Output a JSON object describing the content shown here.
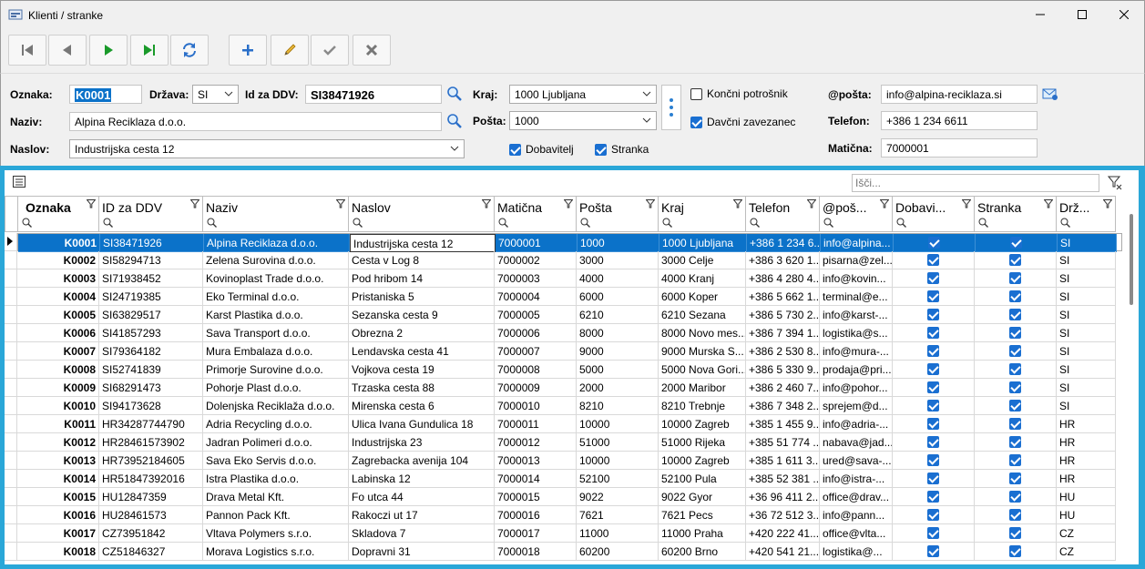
{
  "window": {
    "title": "Klienti / stranke"
  },
  "form": {
    "oznaka_label": "Oznaka:",
    "oznaka_value": "K0001",
    "drzava_label": "Država:",
    "drzava_value": "SI",
    "ddv_label": "Id za DDV:",
    "ddv_value": "SI38471926",
    "kraj_label": "Kraj:",
    "kraj_value": "1000 Ljubljana",
    "koncni_label": "Končni potrošnik",
    "davcni_label": "Davčni zavezanec",
    "posta_email_label": "@pošta:",
    "email_value": "info@alpina-reciklaza.si",
    "naziv_label": "Naziv:",
    "naziv_value": "Alpina Reciklaza d.o.o.",
    "posta_label": "Pošta:",
    "posta_value": "1000",
    "telefon_label": "Telefon:",
    "telefon_value": "+386 1 234 6611",
    "naslov_label": "Naslov:",
    "naslov_value": "Industrijska cesta 12",
    "dobavitelj_label": "Dobavitelj",
    "stranka_label": "Stranka",
    "maticna_label": "Matična:",
    "maticna_value": "7000001"
  },
  "grid": {
    "search_placeholder": "Išči...",
    "columns": [
      "Oznaka",
      "ID za DDV",
      "Naziv",
      "Naslov",
      "Matična",
      "Pošta",
      "Kraj",
      "Telefon",
      "@poš...",
      "Dobavi...",
      "Stranka",
      "Drž..."
    ],
    "rows": [
      [
        "K0001",
        "SI38471926",
        "Alpina Reciklaza d.o.o.",
        "Industrijska cesta 12",
        "7000001",
        "1000",
        "1000 Ljubljana",
        "+386 1 234 6...",
        "info@alpina...",
        "SI"
      ],
      [
        "K0002",
        "SI58294713",
        "Zelena Surovina d.o.o.",
        "Cesta v Log 8",
        "7000002",
        "3000",
        "3000 Celje",
        "+386 3 620 1...",
        "pisarna@zel...",
        "SI"
      ],
      [
        "K0003",
        "SI71938452",
        "Kovinoplast Trade d.o.o.",
        "Pod hribom 14",
        "7000003",
        "4000",
        "4000 Kranj",
        "+386 4 280 4...",
        "info@kovin...",
        "SI"
      ],
      [
        "K0004",
        "SI24719385",
        "Eko Terminal d.o.o.",
        "Pristaniska 5",
        "7000004",
        "6000",
        "6000 Koper",
        "+386 5 662 1...",
        "terminal@e...",
        "SI"
      ],
      [
        "K0005",
        "SI63829517",
        "Karst Plastika d.o.o.",
        "Sezanska cesta 9",
        "7000005",
        "6210",
        "6210 Sezana",
        "+386 5 730 2...",
        "info@karst-...",
        "SI"
      ],
      [
        "K0006",
        "SI41857293",
        "Sava Transport d.o.o.",
        "Obrezna 2",
        "7000006",
        "8000",
        "8000 Novo mes...",
        "+386 7 394 1...",
        "logistika@s...",
        "SI"
      ],
      [
        "K0007",
        "SI79364182",
        "Mura Embalaza d.o.o.",
        "Lendavska cesta 41",
        "7000007",
        "9000",
        "9000 Murska S...",
        "+386 2 530 8...",
        "info@mura-...",
        "SI"
      ],
      [
        "K0008",
        "SI52741839",
        "Primorje Surovine d.o.o.",
        "Vojkova cesta 19",
        "7000008",
        "5000",
        "5000 Nova Gori...",
        "+386 5 330 9...",
        "prodaja@pri...",
        "SI"
      ],
      [
        "K0009",
        "SI68291473",
        "Pohorje Plast d.o.o.",
        "Trzaska cesta 88",
        "7000009",
        "2000",
        "2000 Maribor",
        "+386 2 460 7...",
        "info@pohor...",
        "SI"
      ],
      [
        "K0010",
        "SI94173628",
        "Dolenjska Reciklaža d.o.o.",
        "Mirenska cesta 6",
        "7000010",
        "8210",
        "8210 Trebnje",
        "+386 7 348 2...",
        "sprejem@d...",
        "SI"
      ],
      [
        "K0011",
        "HR34287744790",
        "Adria Recycling d.o.o.",
        "Ulica Ivana Gundulica 18",
        "7000011",
        "10000",
        "10000 Zagreb",
        "+385 1 455 9...",
        "info@adria-...",
        "HR"
      ],
      [
        "K0012",
        "HR28461573902",
        "Jadran Polimeri d.o.o.",
        "Industrijska 23",
        "7000012",
        "51000",
        "51000 Rijeka",
        "+385 51 774 ...",
        "nabava@jad...",
        "HR"
      ],
      [
        "K0013",
        "HR73952184605",
        "Sava Eko Servis d.o.o.",
        "Zagrebacka avenija 104",
        "7000013",
        "10000",
        "10000 Zagreb",
        "+385 1 611 3...",
        "ured@sava-...",
        "HR"
      ],
      [
        "K0014",
        "HR51847392016",
        "Istra Plastika d.o.o.",
        "Labinska 12",
        "7000014",
        "52100",
        "52100 Pula",
        "+385 52 381 ...",
        "info@istra-...",
        "HR"
      ],
      [
        "K0015",
        "HU12847359",
        "Drava Metal Kft.",
        "Fo utca 44",
        "7000015",
        "9022",
        "9022 Gyor",
        "+36 96 411 2...",
        "office@drav...",
        "HU"
      ],
      [
        "K0016",
        "HU28461573",
        "Pannon Pack Kft.",
        "Rakoczi ut 17",
        "7000016",
        "7621",
        "7621 Pecs",
        "+36 72 512 3...",
        "info@pann...",
        "HU"
      ],
      [
        "K0017",
        "CZ73951842",
        "Vltava Polymers s.r.o.",
        "Skladova 7",
        "7000017",
        "11000",
        "11000 Praha",
        "+420 222 41...",
        "office@vlta...",
        "CZ"
      ],
      [
        "K0018",
        "CZ51846327",
        "Morava Logistics s.r.o.",
        "Dopravni 31",
        "7000018",
        "60200",
        "60200 Brno",
        "+420 541 21...",
        "logistika@...",
        "CZ"
      ]
    ]
  },
  "colors": {
    "accent": "#2aa7d8",
    "selection": "#0b72c9",
    "check": "#1a6fd1"
  }
}
